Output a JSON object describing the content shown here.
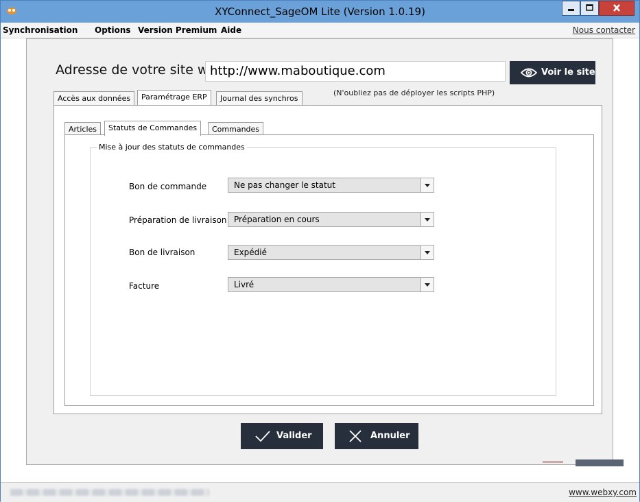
{
  "window": {
    "title": "XYConnect_SageOM Lite (Version 1.0.19)"
  },
  "menu": {
    "items": [
      "Synchronisation",
      "Options",
      "Version Premium",
      "Aide"
    ],
    "contact": "Nous contacter"
  },
  "site": {
    "label": "Adresse de votre site web :",
    "url": "http://www.maboutique.com",
    "view_button": "Voir le site",
    "note": "(N'oubliez pas de déployer les scripts PHP)"
  },
  "tabs": [
    {
      "label": "Accès aux données"
    },
    {
      "label": "Paramétrage ERP",
      "selected": true
    },
    {
      "label": "Journal des synchros"
    }
  ],
  "subtabs": [
    {
      "label": "Articles"
    },
    {
      "label": "Statuts de Commandes",
      "selected": true
    },
    {
      "label": "Commandes"
    }
  ],
  "group": {
    "title": "Mise à jour des statuts de commandes",
    "rows": [
      {
        "label": "Bon de commande",
        "value": "Ne pas changer le statut"
      },
      {
        "label": "Préparation de livraison",
        "value": "Préparation en cours"
      },
      {
        "label": "Bon de livraison",
        "value": "Expédié"
      },
      {
        "label": "Facture",
        "value": "Livré"
      }
    ]
  },
  "buttons": {
    "ok": "Valider",
    "cancel": "Annuler"
  },
  "status": {
    "link": "www.webxy.com"
  },
  "colors": {
    "titlebar": "#6aa1d9",
    "dark_button": "#272f3d",
    "close": "#c7423a"
  }
}
